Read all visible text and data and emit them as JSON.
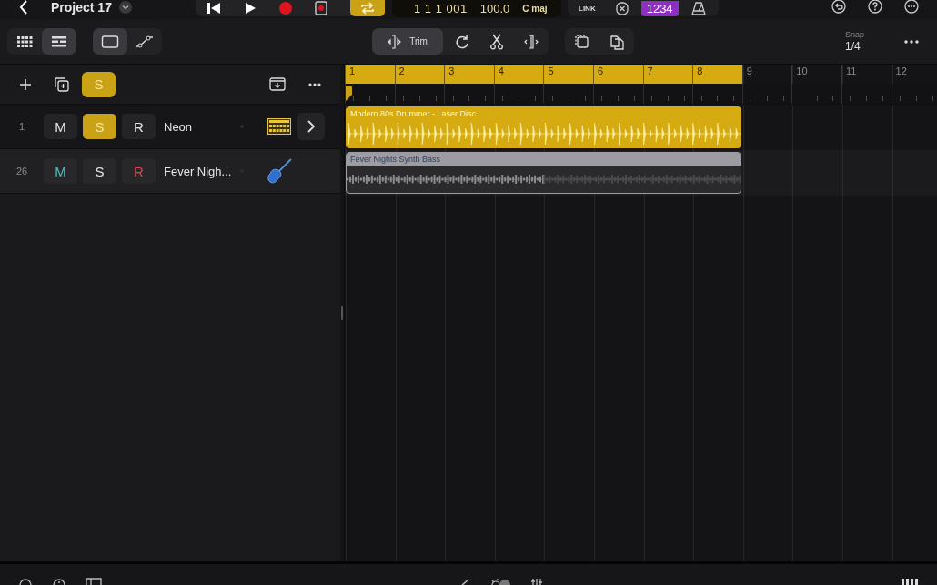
{
  "topbar": {
    "project_title": "Project 17",
    "cycle_on": true,
    "lcd": {
      "position": "1 1 1 001",
      "tempo": "100.0",
      "key": "C maj"
    },
    "link_label": "LINK",
    "count_in": {
      "label": "1234",
      "on": true
    }
  },
  "toolbar": {
    "view_buttons": [
      {
        "kind": "grid",
        "selected": false
      },
      {
        "kind": "tracks",
        "selected": true
      }
    ],
    "mode_buttons": [
      {
        "kind": "region",
        "selected": true
      },
      {
        "kind": "automation",
        "selected": false
      }
    ],
    "tools": [
      {
        "kind": "trim",
        "label": "Trim",
        "selected": true
      },
      {
        "kind": "loop",
        "selected": false
      },
      {
        "kind": "scissors",
        "selected": false
      },
      {
        "kind": "split",
        "selected": false
      }
    ],
    "snap": {
      "label": "Snap",
      "value": "1/4"
    }
  },
  "track_header": {
    "solo_label": "S",
    "solo_on": true
  },
  "ruler": {
    "bars": [
      {
        "label": "1",
        "in_cycle": true
      },
      {
        "label": "2",
        "in_cycle": true
      },
      {
        "label": "3",
        "in_cycle": true
      },
      {
        "label": "4",
        "in_cycle": true
      },
      {
        "label": "5",
        "in_cycle": true
      },
      {
        "label": "6",
        "in_cycle": true
      },
      {
        "label": "7",
        "in_cycle": true
      },
      {
        "label": "8",
        "in_cycle": true
      },
      {
        "label": "9",
        "in_cycle": false
      },
      {
        "label": "10",
        "in_cycle": false
      },
      {
        "label": "11",
        "in_cycle": false
      },
      {
        "label": "12",
        "in_cycle": false
      }
    ]
  },
  "tracks": [
    {
      "number": "1",
      "mute_label": "M",
      "solo_label": "S",
      "record_label": "R",
      "name": "Neon",
      "muted": false,
      "solo": true,
      "armed": false,
      "kind": "drum-machine",
      "has_expand": true,
      "region": {
        "name": "Modern 80s Drummer - Laser Disc",
        "kind": "drums",
        "color": "#d6ab12"
      }
    },
    {
      "number": "26",
      "mute_label": "M",
      "solo_label": "S",
      "record_label": "R",
      "name": "Fever Nigh...",
      "muted": true,
      "solo": false,
      "armed": true,
      "kind": "bass",
      "has_expand": false,
      "region": {
        "name": "Fever Nights Synth Bass",
        "kind": "bass",
        "color": "#9c9ca2"
      }
    }
  ]
}
